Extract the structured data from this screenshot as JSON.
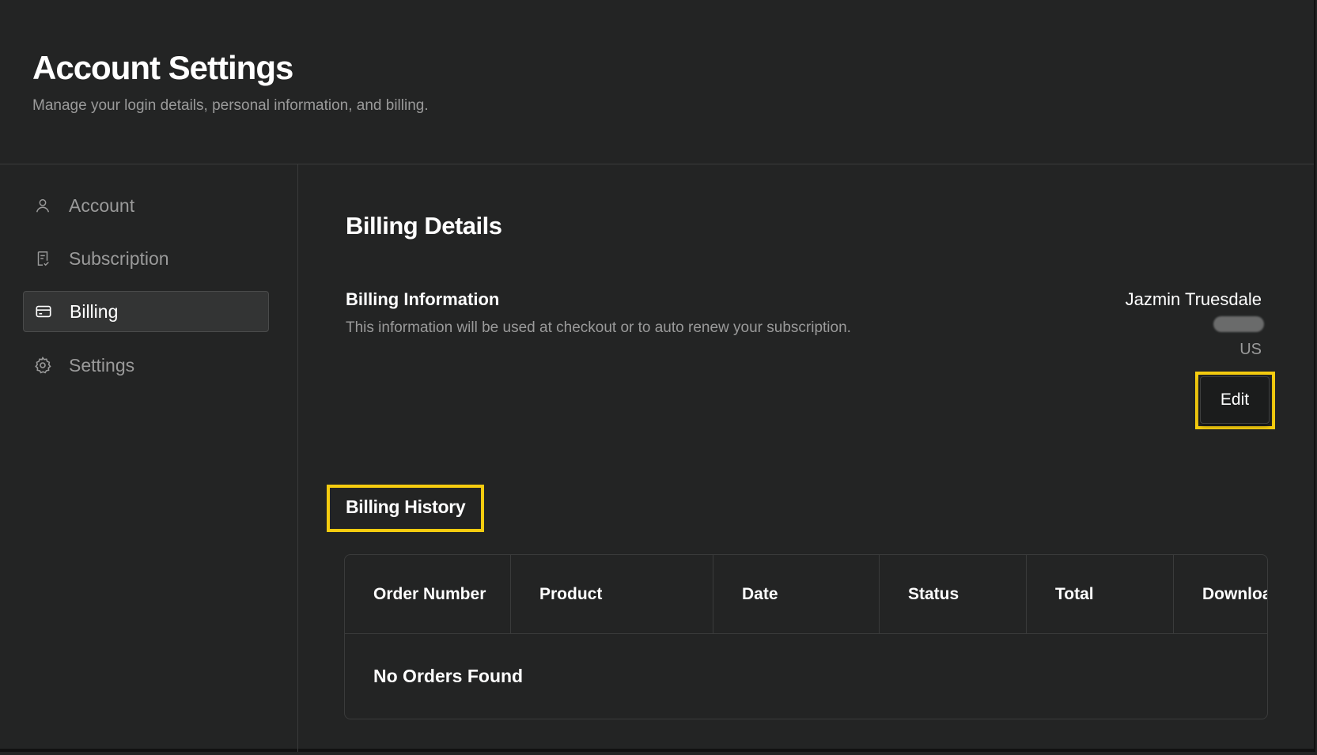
{
  "header": {
    "title": "Account Settings",
    "subtitle": "Manage your login details, personal information, and billing."
  },
  "sidebar": {
    "items": [
      {
        "label": "Account",
        "icon": "user-icon",
        "active": false
      },
      {
        "label": "Subscription",
        "icon": "receipt-icon",
        "active": false
      },
      {
        "label": "Billing",
        "icon": "credit-card-icon",
        "active": true
      },
      {
        "label": "Settings",
        "icon": "gear-icon",
        "active": false
      }
    ]
  },
  "billing": {
    "section_title": "Billing Details",
    "info_title": "Billing Information",
    "info_description": "This information will be used at checkout or to auto renew your subscription.",
    "name": "Jazmin Truesdale",
    "country": "US",
    "edit_label": "Edit"
  },
  "history": {
    "title": "Billing History",
    "columns": [
      "Order Number",
      "Product",
      "Date",
      "Status",
      "Total",
      "Download"
    ],
    "empty_message": "No Orders Found"
  },
  "colors": {
    "background": "#232424",
    "highlight": "#f5cc0f",
    "muted_text": "#9a9a9a",
    "active_item": "#333434"
  }
}
